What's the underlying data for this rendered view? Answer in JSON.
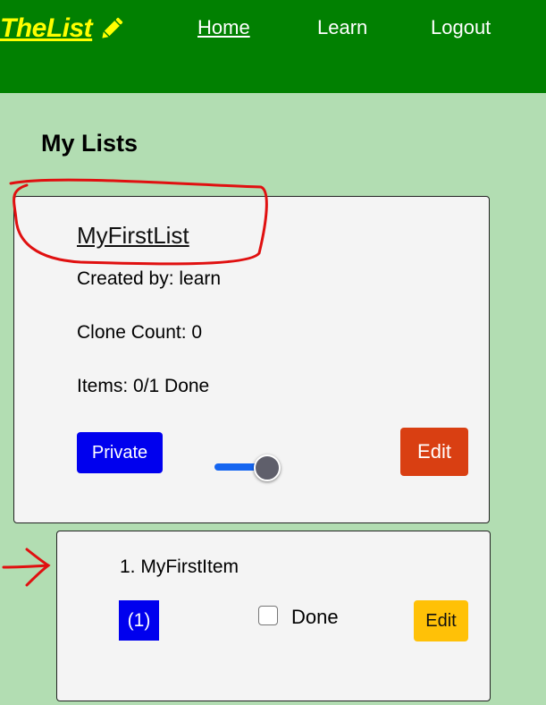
{
  "nav": {
    "brand": "TheList",
    "brand_icon": "pencil-icon",
    "links": [
      "Home",
      "Learn",
      "Logout"
    ]
  },
  "page": {
    "heading": "My Lists"
  },
  "list": {
    "title": "MyFirstList",
    "created_by": "Created by: learn",
    "clone_count": "Clone Count: 0",
    "items_done": "Items: 0/1 Done",
    "private_label": "Private",
    "toggle_on": true,
    "edit_label": "Edit"
  },
  "item": {
    "name": "1. MyFirstItem",
    "badge": "(1)",
    "done_label": "Done",
    "done_checked": false,
    "edit_label": "Edit"
  },
  "colors": {
    "navbar": "#018001",
    "background": "#b2ddb2",
    "brand": "#ffff00",
    "private_button": "#0000ee",
    "list_edit_button": "#d93f12",
    "item_edit_button": "#ffc107",
    "annotation": "#e01010"
  }
}
